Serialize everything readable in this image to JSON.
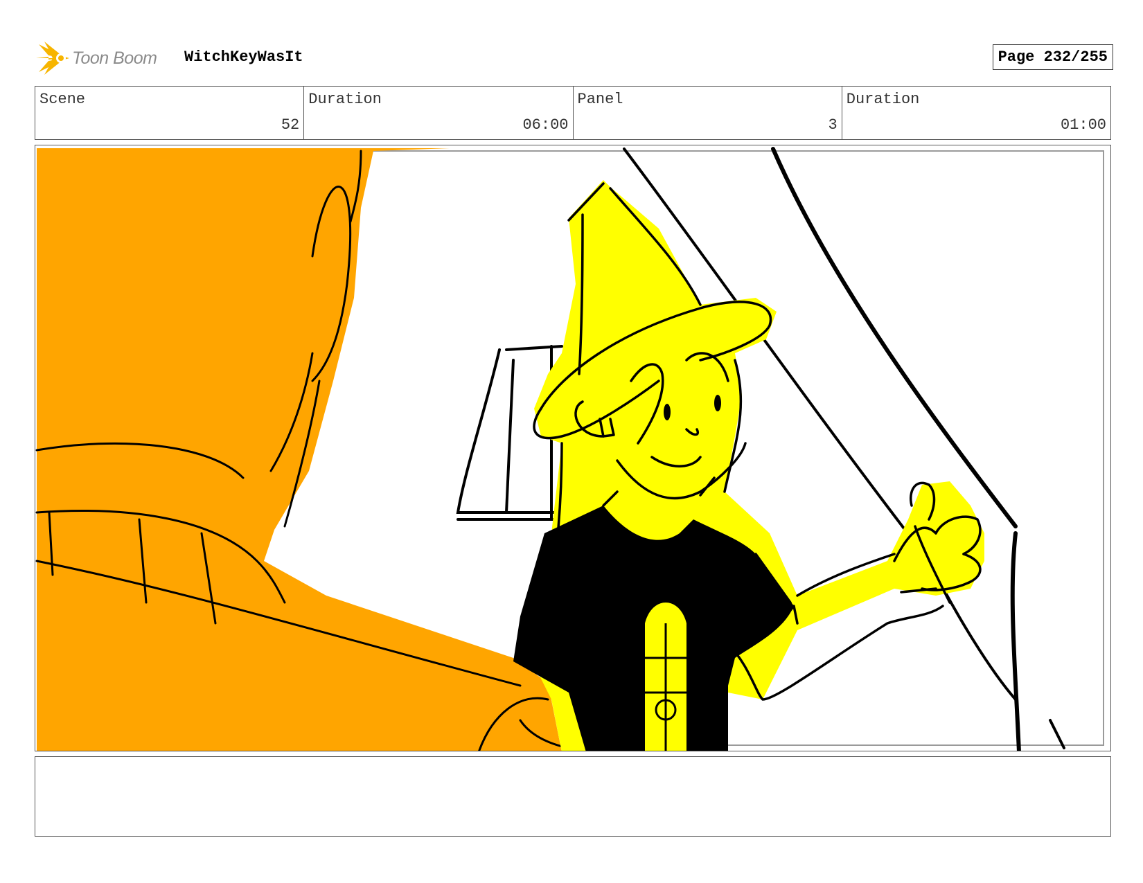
{
  "header": {
    "logo_text": "Toon Boom",
    "project_title": "WitchKeyWasIt",
    "page_label": "Page 232/255"
  },
  "info": {
    "scene_label": "Scene",
    "scene_value": "52",
    "scene_duration_label": "Duration",
    "scene_duration_value": "06:00",
    "panel_label": "Panel",
    "panel_value": "3",
    "panel_duration_label": "Duration",
    "panel_duration_value": "01:00"
  },
  "panel": {
    "colors": {
      "foreground_figure": "#FFA500",
      "witch_fill": "#FFFF00",
      "ink": "#000000",
      "background": "#FFFFFF"
    }
  },
  "notes": {
    "text": ""
  }
}
